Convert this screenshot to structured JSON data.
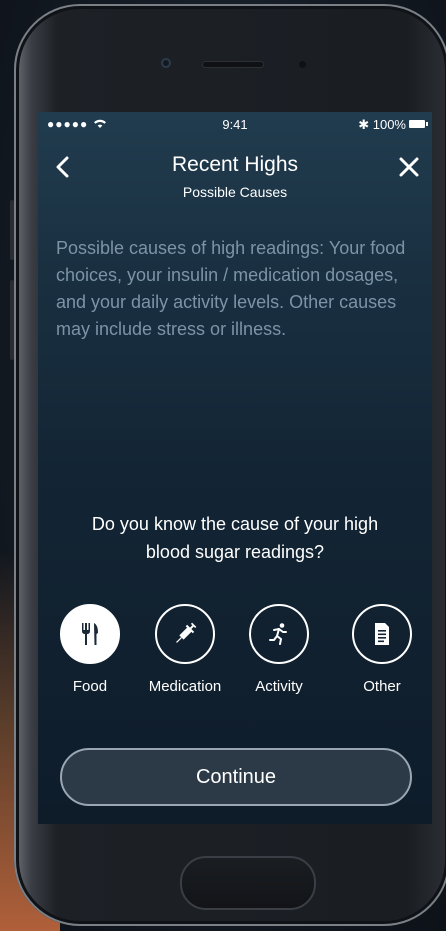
{
  "status_bar": {
    "signal": "●●●●● ",
    "time": "9:41",
    "battery": "✱ 100%"
  },
  "nav": {
    "title": "Recent Highs",
    "subtitle": "Possible Causes"
  },
  "description": "Possible causes of high readings: Your food choices, your insulin / medication dosages, and your daily activity levels. Other causes may include stress or illness.",
  "question": "Do you know the cause of your high blood sugar readings?",
  "options": [
    {
      "label": "Food",
      "icon": "fork-knife-icon",
      "selected": true
    },
    {
      "label": "Medication",
      "icon": "syringe-icon",
      "selected": false
    },
    {
      "label": "Activity",
      "icon": "running-icon",
      "selected": false
    },
    {
      "label": "Other",
      "icon": "document-icon",
      "selected": false
    }
  ],
  "continue_label": "Continue",
  "colors": {
    "screen_top": "#213c4f",
    "screen_bottom": "#0e1c2a",
    "description_text": "#7d93a6",
    "button_bg": "#2c3a48"
  }
}
